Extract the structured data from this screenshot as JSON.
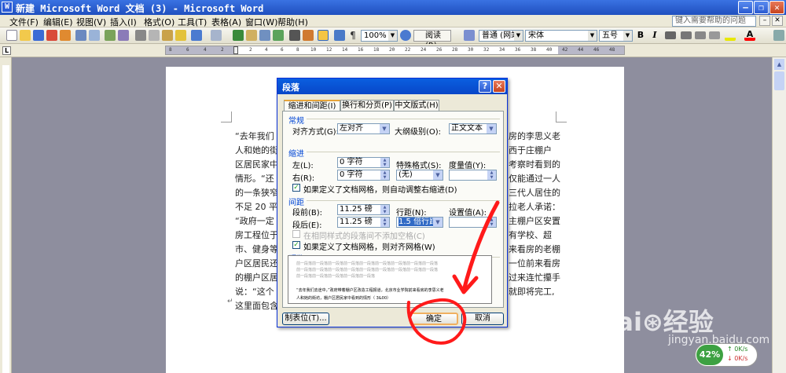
{
  "window": {
    "icon": "W",
    "title": "新建 Microsoft Word 文档 (3) - Microsoft Word"
  },
  "menu": {
    "items": [
      "文件(F)",
      "编辑(E)",
      "视图(V)",
      "插入(I)",
      "格式(O)",
      "工具(T)",
      "表格(A)",
      "窗口(W)",
      "帮助(H)"
    ],
    "ask_placeholder": "键入需要帮助的问题"
  },
  "toolbar": {
    "zoom": "100%",
    "read_label": "阅读(R)",
    "style": "普通 (网站)",
    "font": "宋体",
    "size": "五号",
    "bold": "B",
    "italic": "I",
    "underline_color": "#e8e800",
    "font_color": "#ff0000"
  },
  "ruler": {
    "corner": "L",
    "left_labels": [
      "8",
      "6",
      "4",
      "2"
    ],
    "right_labels": [
      "2",
      "4",
      "6",
      "8",
      "10",
      "12",
      "14",
      "16",
      "18",
      "20",
      "22",
      "24",
      "26",
      "28",
      "30",
      "32",
      "34",
      "36",
      "38",
      "40",
      "42",
      "44",
      "46",
      "48"
    ]
  },
  "document": {
    "left": [
      "“去年我们",
      "人和她的街",
      "区居民家中",
      "情形。“还",
      "的一条狭窄",
      "不足 20 平方",
      "“政府一定",
      "房工程位于",
      "市、健身等",
      "户区居民还",
      "的棚户区居",
      "说：“这个",
      "这里面包含"
    ],
    "right": [
      "房的李思义老",
      "西于庄棚户",
      "考察时看到的",
      "仅能通过一人",
      "三代人居住的",
      "拉老人承诺：",
      "主棚户区安置",
      "有学校、超",
      "来看房的老棚",
      "一位前来看房",
      "过来连忙攥手",
      "就即将完工,"
    ],
    "cursor_mark": "↵"
  },
  "dialog": {
    "title": "段落",
    "help_btn": "?",
    "close_btn": "✕",
    "tabs": [
      "缩进和间距(I)",
      "换行和分页(P)",
      "中文版式(H)"
    ],
    "general": {
      "heading": "常规",
      "align_label": "对齐方式(G):",
      "align_value": "左对齐",
      "outline_label": "大纲级别(O):",
      "outline_value": "正文文本"
    },
    "indent": {
      "heading": "缩进",
      "left_label": "左(L):",
      "left_value": "0 字符",
      "right_label": "右(R):",
      "right_value": "0 字符",
      "special_label": "特殊格式(S):",
      "special_value": "(无)",
      "measure_label": "度量值(Y):",
      "auto_adjust": "如果定义了文档网格，则自动调整右缩进(D)"
    },
    "spacing": {
      "heading": "间距",
      "before_label": "段前(B):",
      "before_value": "11.25 磅",
      "after_label": "段后(E):",
      "after_value": "11.25 磅",
      "line_label": "行距(N):",
      "line_value": "1.5 倍行距",
      "setting_label": "设置值(A):",
      "no_space": "在相同样式的段落间不添加空格(C)",
      "snap_grid": "如果定义了文档网格，则对齐网格(W)"
    },
    "preview": {
      "heading": "预览",
      "sample_lines": [
        "前一段落前一段落前一段落前一段落前一段落前一段落前一段落前一段落前一段落",
        "前一段落前一段落前一段落前一段落前一段落前一段落前一段落前一段落前一段落",
        "前一段落前一段落前一段落前一段落前一段落",
        "“去年我们去途中，”政府带着棚户区改造工程报道，北京市业学院前来看房的李思义老",
        "人和她的街坊，棚户区居民家中看到的情形（ 3&00）"
      ]
    },
    "tabs_btn": "制表位(T)...",
    "ok": "确定",
    "cancel": "取消"
  },
  "watermark": {
    "brand": "Bai⊛经验",
    "url": "jingyan.baidu.com"
  },
  "netmon": {
    "percent": "42%",
    "up": "0K/s",
    "down": "0K/s"
  }
}
